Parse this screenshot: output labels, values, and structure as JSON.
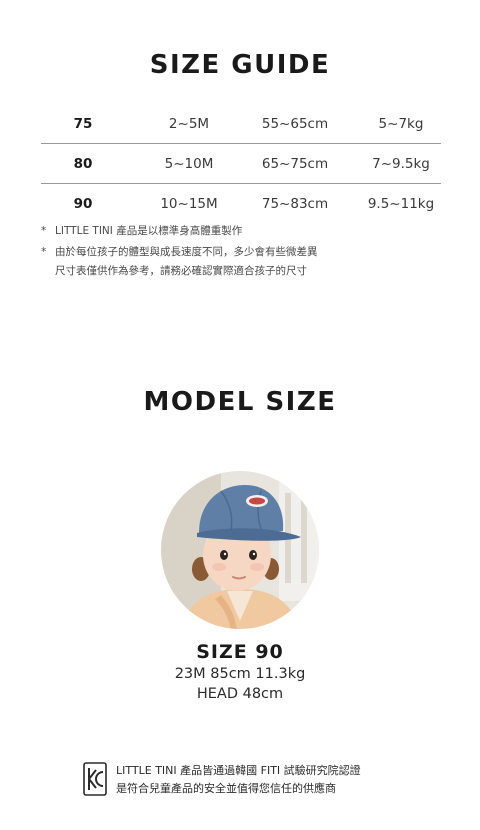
{
  "size_guide": {
    "title": "SIZE GUIDE",
    "rows": [
      {
        "size": "75",
        "age": "2~5M",
        "height": "55~65cm",
        "weight": "5~7kg"
      },
      {
        "size": "80",
        "age": "5~10M",
        "height": "65~75cm",
        "weight": "7~9.5kg"
      },
      {
        "size": "90",
        "age": "10~15M",
        "height": "75~83cm",
        "weight": "9.5~11kg"
      }
    ],
    "notes": [
      {
        "star": "*",
        "line1": "LITTLE TINI 產品是以標準身高體重製作",
        "line2": ""
      },
      {
        "star": "*",
        "line1": "由於每位孩子的體型與成長速度不同，多少會有些微差異",
        "line2": "尺寸表僅供作為參考，請務必確認實際適合孩子的尺寸"
      }
    ]
  },
  "model_size": {
    "title": "MODEL SIZE",
    "size_label": "SIZE 90",
    "stats_line": "23M 85cm 11.3kg",
    "head_line": "HEAD 48cm"
  },
  "certification": {
    "mark": "KC",
    "line1": "LITTLE TINI 產品皆通過韓國 FITI 試驗研究院認證",
    "line2": "是符合兒童產品的安全並值得您信任的供應商"
  }
}
